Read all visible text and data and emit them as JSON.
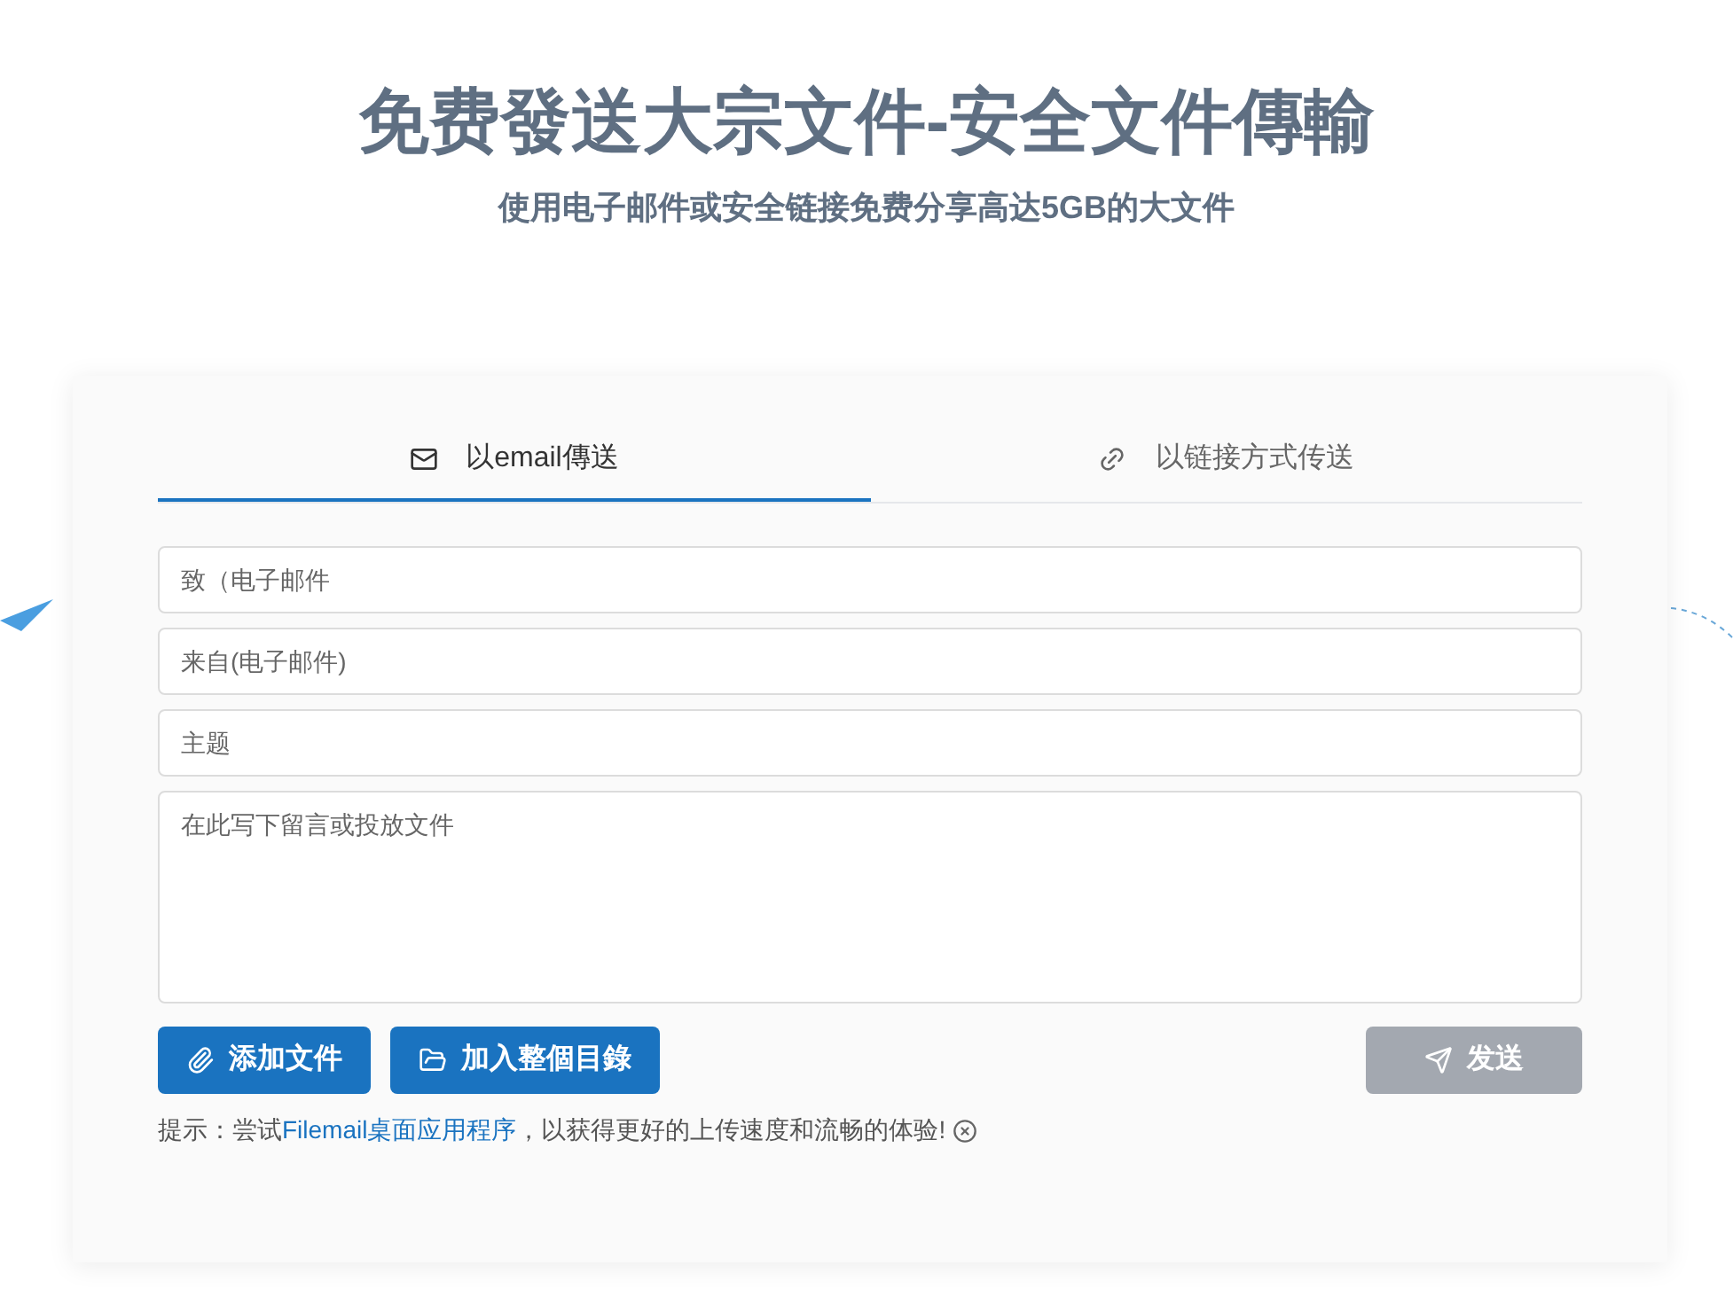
{
  "header": {
    "title": "免费發送大宗文件-安全文件傳輸",
    "subtitle": "使用电子邮件或安全链接免费分享高达5GB的大文件"
  },
  "tabs": [
    {
      "label": "以email傳送",
      "kind": "email",
      "selected": true
    },
    {
      "label": "以链接方式传送",
      "kind": "link",
      "selected": false
    }
  ],
  "fields": [
    {
      "kind": "input",
      "placeholder": "致（电子邮件"
    },
    {
      "kind": "input",
      "placeholder": "来自(电子邮件)"
    },
    {
      "kind": "input",
      "placeholder": "主题"
    },
    {
      "kind": "textarea",
      "placeholder": "在此写下留言或投放文件"
    }
  ],
  "buttons": [
    {
      "label": "添加文件",
      "kind": "file",
      "disabled": false
    },
    {
      "label": "加入整個目錄",
      "kind": "folder",
      "disabled": false
    }
  ],
  "send_button": {
    "label": "发送",
    "disabled": true
  },
  "hint": {
    "prefix": "提示：尝试",
    "link": "Filemail桌面应用程序",
    "suffix": "，以获得更好的上传速度和流畅的体验!"
  }
}
